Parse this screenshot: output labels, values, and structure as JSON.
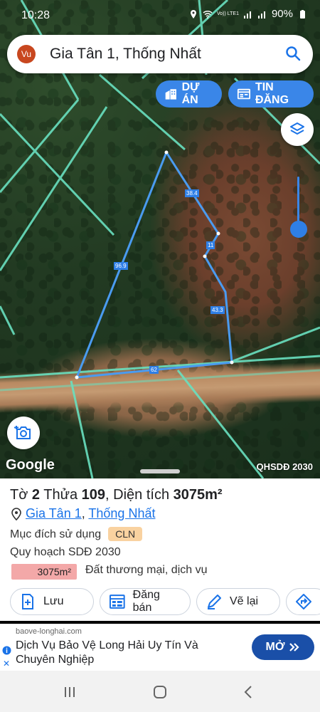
{
  "status_bar": {
    "time": "10:28",
    "network": "Vo)) LTE1",
    "battery": "90%"
  },
  "search": {
    "avatar": "Vu",
    "query": "Gia Tân 1, Thống Nhất"
  },
  "map_buttons": {
    "du_an": "DỰ ÁN",
    "tin_dang": "TIN ĐĂNG"
  },
  "parcel_edges": [
    "38.4",
    "11",
    "96.9",
    "43.3",
    "62"
  ],
  "map_labels": {
    "google": "Google",
    "layer_name": "QHSDĐ 2030"
  },
  "parcel": {
    "to_label": "Tờ",
    "to_value": "2",
    "thua_label": "Thửa",
    "thua_value": "109",
    "dientich_label": "Diện tích",
    "dientich_value": "3075m²",
    "location_1": "Gia Tân 1",
    "location_2": "Thống Nhất",
    "muc_dich_label": "Mục đích sử dụng",
    "muc_dich_value": "CLN",
    "quy_hoach_label": "Quy hoạch SDĐ 2030",
    "quy_hoach_area": "3075m²",
    "quy_hoach_desc": "Đất thương mại, dịch vụ"
  },
  "actions": {
    "luu": "Lưu",
    "dang_ban": "Đăng bán",
    "ve_lai": "Vẽ lại"
  },
  "ad": {
    "domain": "baove-longhai.com",
    "headline": "Dịch Vụ Bảo Vệ Long Hải Uy Tín Và Chuyên Nghiệp",
    "cta": "MỞ"
  },
  "colors": {
    "accent": "#3a86e8",
    "parcel_line": "#4a9bf0",
    "cadastral_line": "#69e0c0",
    "ad_cta": "#1a4fa8"
  }
}
